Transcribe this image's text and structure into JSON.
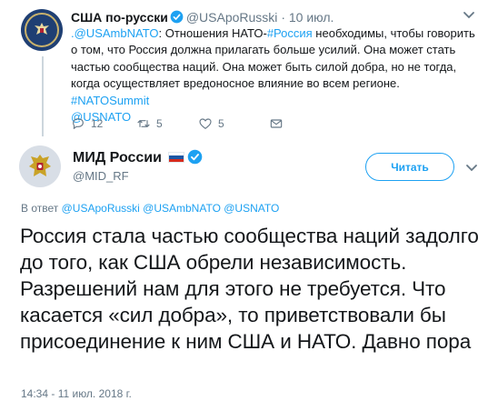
{
  "parent_tweet": {
    "name": "США по-русски",
    "handle": "@USApoRusski",
    "separator": "·",
    "time": "10 июл.",
    "text": {
      "mention1": ".@USAmbNATO",
      "part1": ": Отношения НАТО-",
      "hashtag1": "#Россия",
      "part2": " необходимы, чтобы говорить о том, что Россия должна прилагать больше усилий. Она может стать частью сообщества наций. Она может быть силой добра, но не тогда, когда осуществляет вредоносное влияние во всем регионе. ",
      "hashtag2": "#NATOSummit",
      "mention2": "@USNATO"
    },
    "actions": {
      "reply_count": "12",
      "retweet_count": "5",
      "like_count": "5"
    }
  },
  "main_tweet": {
    "name": "МИД России",
    "handle": "@MID_RF",
    "follow_label": "Читать",
    "reply_to_prefix": "В ответ",
    "reply_to_mentions": "@USApoRusski @USAmbNATO @USNATO",
    "text": "Россия стала частью сообщества наций задолго до того, как США обрели независимость. Разрешений нам для этого не требуется. Что касается «сил добра», то приветствовали бы присоединение к ним США и НАТО. Давно пора",
    "timestamp": "14:34 - 11 июл. 2018 г."
  },
  "colors": {
    "accent": "#1da1f2",
    "secondary_text": "#657786",
    "primary_text": "#14171a",
    "like": "#e0245e",
    "retweet": "#17bf63"
  },
  "icons": {
    "verified": "verified-badge-icon",
    "caret": "chevron-down-icon",
    "reply": "reply-icon",
    "retweet": "retweet-icon",
    "like": "heart-icon",
    "dm": "envelope-icon",
    "flag": "russia-flag-icon"
  }
}
